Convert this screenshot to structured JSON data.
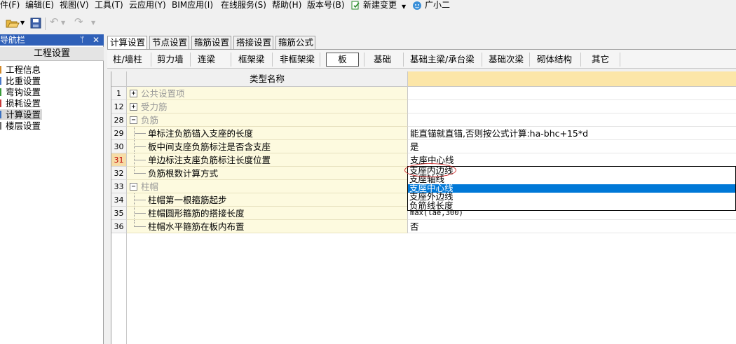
{
  "menu": {
    "items": [
      "件(F)",
      "编辑(E)",
      "视图(V)",
      "工具(T)",
      "云应用(Y)",
      "BIM应用(I)",
      "在线服务(S)",
      "帮助(H)",
      "版本号(B)"
    ],
    "new_change": "新建变更",
    "assistant": "广小二"
  },
  "nav": {
    "title": "导航栏",
    "pin": "ᛘ",
    "close": "✕",
    "group": "工程设置",
    "items": [
      "工程信息",
      "比重设置",
      "弯钩设置",
      "损耗设置",
      "计算设置",
      "楼层设置"
    ]
  },
  "tabs": [
    "计算设置",
    "节点设置",
    "箍筋设置",
    "搭接设置",
    "箍筋公式"
  ],
  "subtabs": [
    "柱/墙柱",
    "剪力墙",
    "连梁",
    "框架梁",
    "非框架梁",
    "板",
    "基础",
    "基础主梁/承台梁",
    "基础次梁",
    "砌体结构",
    "其它"
  ],
  "grid": {
    "header_name": "类型名称",
    "header_value": "",
    "rows": [
      {
        "num": "1",
        "name": "公共设置项",
        "value": "",
        "expander": "+"
      },
      {
        "num": "12",
        "name": "受力筋",
        "value": "",
        "expander": "+"
      },
      {
        "num": "28",
        "name": "负筋",
        "value": "",
        "expander": "−"
      },
      {
        "num": "29",
        "name": "单标注负筋锚入支座的长度",
        "value": "能直锚就直锚,否则按公式计算:ha-bhc+15*d"
      },
      {
        "num": "30",
        "name": "板中间支座负筋标注是否含支座",
        "value": "是"
      },
      {
        "num": "31",
        "name": "单边标注支座负筋标注长度位置",
        "value": "支座中心线"
      },
      {
        "num": "32",
        "name": "负筋根数计算方式",
        "value": ""
      },
      {
        "num": "33",
        "name": "柱帽",
        "value": "",
        "expander": "−"
      },
      {
        "num": "34",
        "name": "柱帽第一根箍筋起步",
        "value": ""
      },
      {
        "num": "35",
        "name": "柱帽圆形箍筋的搭接长度",
        "value": "max(lae,300)"
      },
      {
        "num": "36",
        "name": "柱帽水平箍筋在板内布置",
        "value": "否"
      }
    ]
  },
  "dropdown": {
    "options": [
      "支座内边线",
      "支座轴线",
      "支座中心线",
      "支座外边线",
      "负筋线长度"
    ],
    "selected_index": 2
  },
  "colors": {
    "nav_header": "#2f60b8",
    "value_header": "#fce6a8",
    "name_cell": "#fdfadf",
    "selection": "#0078d7",
    "annotation": "#d03030"
  }
}
